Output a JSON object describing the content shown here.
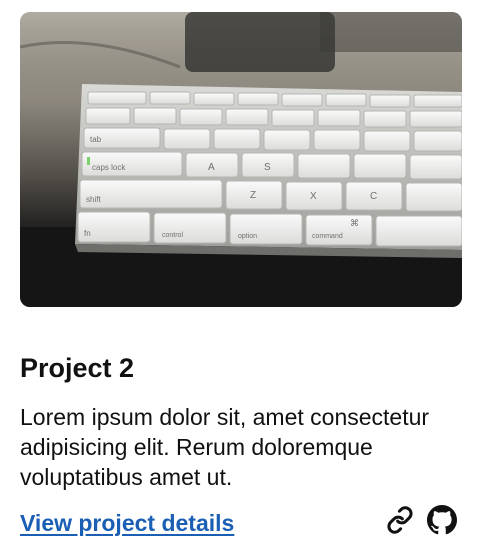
{
  "project": {
    "title": "Project 2",
    "description": "Lorem ipsum dolor sit, amet consectetur adipisicing elit. Rerum doloremque voluptatibus amet ut.",
    "details_link": "View project details",
    "image": {
      "subject": "keyboard-photo",
      "key_labels": [
        "tab",
        "caps lock",
        "A",
        "S",
        "Z",
        "X",
        "C",
        "shift",
        "fn",
        "control",
        "option",
        "command",
        "⌘"
      ]
    }
  },
  "icons": {
    "link": "link-icon",
    "github": "github-icon"
  },
  "colors": {
    "text": "#111111",
    "link": "#1a5fb4",
    "background": "#ffffff"
  }
}
